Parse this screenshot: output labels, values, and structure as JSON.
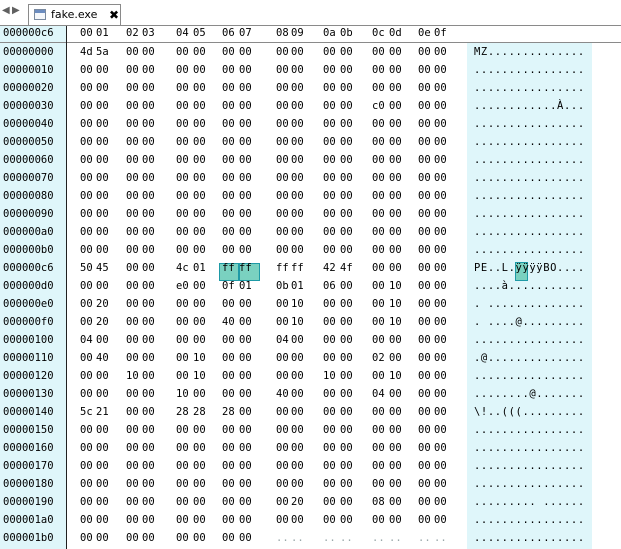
{
  "tabbar": {
    "nav_left": "◀",
    "nav_right": "▶",
    "file_icon": "document-icon",
    "tab_title": "fake.exe",
    "close_glyph": "✖"
  },
  "header": {
    "current_offset": "000000c6",
    "columns": [
      "00",
      "01",
      "02",
      "03",
      "04",
      "05",
      "06",
      "07",
      "08",
      "09",
      "0a",
      "0b",
      "0c",
      "0d",
      "0e",
      "0f"
    ]
  },
  "colors": {
    "gutter": "#dff6fa",
    "selection_fill": "#7ad1c0",
    "selection_border": "#1e9aa6"
  },
  "selection": {
    "offset": "000000c6",
    "bytes": [
      "ff",
      "ff"
    ],
    "ascii": "ÿ"
  },
  "rows": [
    {
      "offset": "00000000",
      "bytes": [
        "4d",
        "5a",
        "00",
        "00",
        "00",
        "00",
        "00",
        "00",
        "00",
        "00",
        "00",
        "00",
        "00",
        "00",
        "00",
        "00"
      ],
      "ascii": "MZ.............."
    },
    {
      "offset": "00000010",
      "bytes": [
        "00",
        "00",
        "00",
        "00",
        "00",
        "00",
        "00",
        "00",
        "00",
        "00",
        "00",
        "00",
        "00",
        "00",
        "00",
        "00"
      ],
      "ascii": "................"
    },
    {
      "offset": "00000020",
      "bytes": [
        "00",
        "00",
        "00",
        "00",
        "00",
        "00",
        "00",
        "00",
        "00",
        "00",
        "00",
        "00",
        "00",
        "00",
        "00",
        "00"
      ],
      "ascii": "................"
    },
    {
      "offset": "00000030",
      "bytes": [
        "00",
        "00",
        "00",
        "00",
        "00",
        "00",
        "00",
        "00",
        "00",
        "00",
        "00",
        "00",
        "c0",
        "00",
        "00",
        "00"
      ],
      "ascii": "............À..."
    },
    {
      "offset": "00000040",
      "bytes": [
        "00",
        "00",
        "00",
        "00",
        "00",
        "00",
        "00",
        "00",
        "00",
        "00",
        "00",
        "00",
        "00",
        "00",
        "00",
        "00"
      ],
      "ascii": "................"
    },
    {
      "offset": "00000050",
      "bytes": [
        "00",
        "00",
        "00",
        "00",
        "00",
        "00",
        "00",
        "00",
        "00",
        "00",
        "00",
        "00",
        "00",
        "00",
        "00",
        "00"
      ],
      "ascii": "................"
    },
    {
      "offset": "00000060",
      "bytes": [
        "00",
        "00",
        "00",
        "00",
        "00",
        "00",
        "00",
        "00",
        "00",
        "00",
        "00",
        "00",
        "00",
        "00",
        "00",
        "00"
      ],
      "ascii": "................"
    },
    {
      "offset": "00000070",
      "bytes": [
        "00",
        "00",
        "00",
        "00",
        "00",
        "00",
        "00",
        "00",
        "00",
        "00",
        "00",
        "00",
        "00",
        "00",
        "00",
        "00"
      ],
      "ascii": "................"
    },
    {
      "offset": "00000080",
      "bytes": [
        "00",
        "00",
        "00",
        "00",
        "00",
        "00",
        "00",
        "00",
        "00",
        "00",
        "00",
        "00",
        "00",
        "00",
        "00",
        "00"
      ],
      "ascii": "................"
    },
    {
      "offset": "00000090",
      "bytes": [
        "00",
        "00",
        "00",
        "00",
        "00",
        "00",
        "00",
        "00",
        "00",
        "00",
        "00",
        "00",
        "00",
        "00",
        "00",
        "00"
      ],
      "ascii": "................"
    },
    {
      "offset": "000000a0",
      "bytes": [
        "00",
        "00",
        "00",
        "00",
        "00",
        "00",
        "00",
        "00",
        "00",
        "00",
        "00",
        "00",
        "00",
        "00",
        "00",
        "00"
      ],
      "ascii": "................"
    },
    {
      "offset": "000000b0",
      "bytes": [
        "00",
        "00",
        "00",
        "00",
        "00",
        "00",
        "00",
        "00",
        "00",
        "00",
        "00",
        "00",
        "00",
        "00",
        "00",
        "00"
      ],
      "ascii": "................"
    },
    {
      "offset": "000000c6",
      "bytes": [
        "50",
        "45",
        "00",
        "00",
        "4c",
        "01",
        "ff",
        "ff",
        "ff",
        "ff",
        "42",
        "4f",
        "00",
        "00",
        "00",
        "00"
      ],
      "ascii": "PE..L.ÿÿÿÿBO...."
    },
    {
      "offset": "000000d0",
      "bytes": [
        "00",
        "00",
        "00",
        "00",
        "e0",
        "00",
        "0f",
        "01",
        "0b",
        "01",
        "06",
        "00",
        "00",
        "10",
        "00",
        "00"
      ],
      "ascii": "....à..........."
    },
    {
      "offset": "000000e0",
      "bytes": [
        "00",
        "20",
        "00",
        "00",
        "00",
        "00",
        "00",
        "00",
        "00",
        "10",
        "00",
        "00",
        "00",
        "10",
        "00",
        "00"
      ],
      "ascii": ". .............."
    },
    {
      "offset": "000000f0",
      "bytes": [
        "00",
        "20",
        "00",
        "00",
        "00",
        "00",
        "40",
        "00",
        "00",
        "10",
        "00",
        "00",
        "00",
        "10",
        "00",
        "00"
      ],
      "ascii": ". ....@........."
    },
    {
      "offset": "00000100",
      "bytes": [
        "04",
        "00",
        "00",
        "00",
        "00",
        "00",
        "00",
        "00",
        "04",
        "00",
        "00",
        "00",
        "00",
        "00",
        "00",
        "00"
      ],
      "ascii": "................"
    },
    {
      "offset": "00000110",
      "bytes": [
        "00",
        "40",
        "00",
        "00",
        "00",
        "10",
        "00",
        "00",
        "00",
        "00",
        "00",
        "00",
        "02",
        "00",
        "00",
        "00"
      ],
      "ascii": ".@.............."
    },
    {
      "offset": "00000120",
      "bytes": [
        "00",
        "00",
        "10",
        "00",
        "00",
        "10",
        "00",
        "00",
        "00",
        "00",
        "10",
        "00",
        "00",
        "10",
        "00",
        "00"
      ],
      "ascii": "................"
    },
    {
      "offset": "00000130",
      "bytes": [
        "00",
        "00",
        "00",
        "00",
        "10",
        "00",
        "00",
        "00",
        "40",
        "00",
        "00",
        "00",
        "04",
        "00",
        "00",
        "00"
      ],
      "ascii": "........@......."
    },
    {
      "offset": "00000140",
      "bytes": [
        "5c",
        "21",
        "00",
        "00",
        "28",
        "28",
        "28",
        "00",
        "00",
        "00",
        "00",
        "00",
        "00",
        "00",
        "00",
        "00"
      ],
      "ascii": "\\!..(((........."
    },
    {
      "offset": "00000150",
      "bytes": [
        "00",
        "00",
        "00",
        "00",
        "00",
        "00",
        "00",
        "00",
        "00",
        "00",
        "00",
        "00",
        "00",
        "00",
        "00",
        "00"
      ],
      "ascii": "................"
    },
    {
      "offset": "00000160",
      "bytes": [
        "00",
        "00",
        "00",
        "00",
        "00",
        "00",
        "00",
        "00",
        "00",
        "00",
        "00",
        "00",
        "00",
        "00",
        "00",
        "00"
      ],
      "ascii": "................"
    },
    {
      "offset": "00000170",
      "bytes": [
        "00",
        "00",
        "00",
        "00",
        "00",
        "00",
        "00",
        "00",
        "00",
        "00",
        "00",
        "00",
        "00",
        "00",
        "00",
        "00"
      ],
      "ascii": "................"
    },
    {
      "offset": "00000180",
      "bytes": [
        "00",
        "00",
        "00",
        "00",
        "00",
        "00",
        "00",
        "00",
        "00",
        "00",
        "00",
        "00",
        "00",
        "00",
        "00",
        "00"
      ],
      "ascii": "................"
    },
    {
      "offset": "00000190",
      "bytes": [
        "00",
        "00",
        "00",
        "00",
        "00",
        "00",
        "00",
        "00",
        "00",
        "20",
        "00",
        "00",
        "08",
        "00",
        "00",
        "00"
      ],
      "ascii": "......... ......"
    },
    {
      "offset": "000001a0",
      "bytes": [
        "00",
        "00",
        "00",
        "00",
        "00",
        "00",
        "00",
        "00",
        "00",
        "00",
        "00",
        "00",
        "00",
        "00",
        "00",
        "00"
      ],
      "ascii": "................"
    },
    {
      "offset": "000001b0",
      "bytes": [
        "00",
        "00",
        "00",
        "00",
        "00",
        "00",
        "00",
        "00",
        "..",
        "..",
        "..",
        "..",
        "..",
        "..",
        "..",
        ".."
      ],
      "ascii": "................"
    }
  ]
}
